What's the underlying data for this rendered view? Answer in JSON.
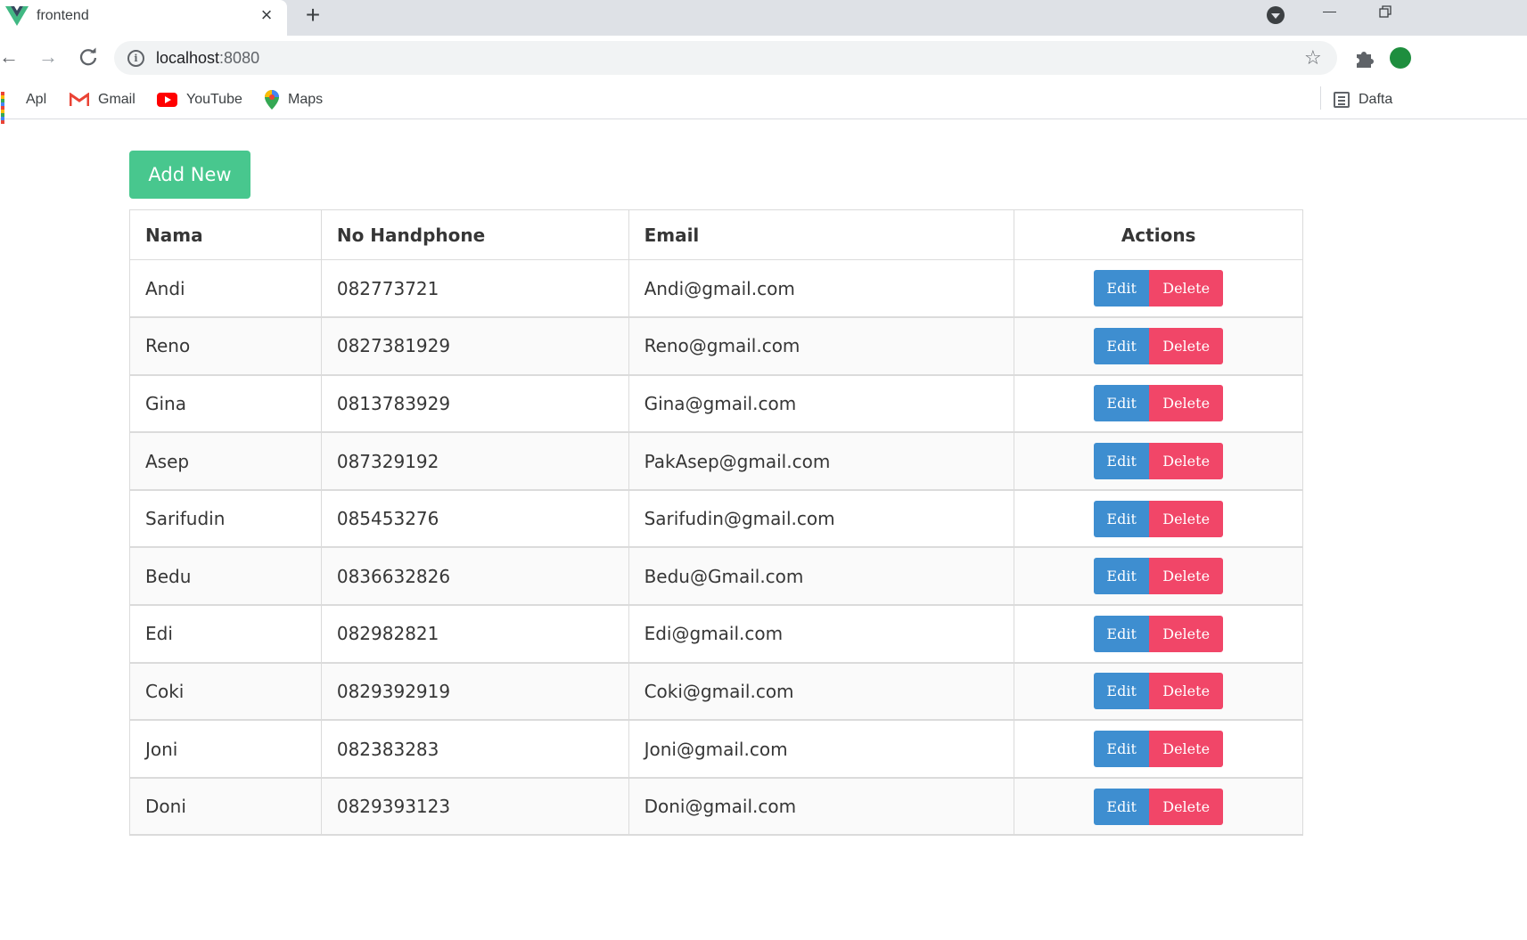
{
  "browser": {
    "tab_title": "frontend",
    "url_host": "localhost",
    "url_port": ":8080",
    "bookmarks": [
      {
        "label": "Apl",
        "icon": "apps-grid-icon"
      },
      {
        "label": "Gmail",
        "icon": "gmail-icon"
      },
      {
        "label": "YouTube",
        "icon": "youtube-icon"
      },
      {
        "label": "Maps",
        "icon": "maps-icon"
      }
    ],
    "reading_list_label": "Dafta"
  },
  "page": {
    "add_button_label": "Add New",
    "columns": [
      "Nama",
      "No Handphone",
      "Email",
      "Actions"
    ],
    "edit_label": "Edit",
    "delete_label": "Delete",
    "rows": [
      {
        "name": "Andi",
        "phone": "082773721",
        "email": "Andi@gmail.com"
      },
      {
        "name": "Reno",
        "phone": "0827381929",
        "email": "Reno@gmail.com"
      },
      {
        "name": "Gina",
        "phone": "0813783929",
        "email": "Gina@gmail.com"
      },
      {
        "name": "Asep",
        "phone": "087329192",
        "email": "PakAsep@gmail.com"
      },
      {
        "name": "Sarifudin",
        "phone": "085453276",
        "email": "Sarifudin@gmail.com"
      },
      {
        "name": "Bedu",
        "phone": "0836632826",
        "email": "Bedu@Gmail.com"
      },
      {
        "name": "Edi",
        "phone": "082982821",
        "email": "Edi@gmail.com"
      },
      {
        "name": "Coki",
        "phone": "0829392919",
        "email": "Coki@gmail.com"
      },
      {
        "name": "Joni",
        "phone": "082383283",
        "email": "Joni@gmail.com"
      },
      {
        "name": "Doni",
        "phone": "0829393123",
        "email": "Doni@gmail.com"
      }
    ]
  },
  "colors": {
    "add_button": "#48c78e",
    "edit_button": "#3e8ed0",
    "delete_button": "#f14668"
  }
}
